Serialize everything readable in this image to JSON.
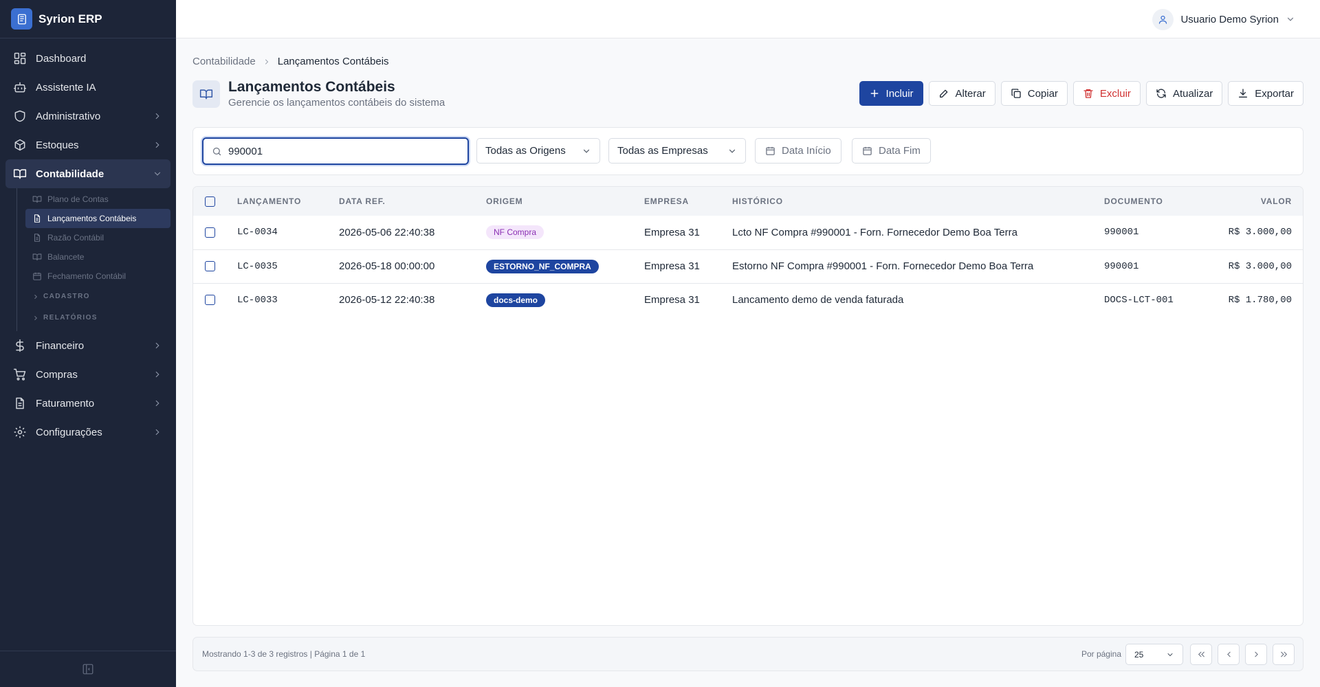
{
  "app": {
    "name": "Syrion ERP"
  },
  "sidebar": {
    "items": [
      {
        "label": "Dashboard",
        "icon": "dashboard-icon"
      },
      {
        "label": "Assistente IA",
        "icon": "bot-icon"
      },
      {
        "label": "Administrativo",
        "icon": "shield-icon"
      },
      {
        "label": "Estoques",
        "icon": "box-icon"
      },
      {
        "label": "Contabilidade",
        "icon": "book-icon"
      },
      {
        "label": "Financeiro",
        "icon": "dollar-icon"
      },
      {
        "label": "Compras",
        "icon": "cart-icon"
      },
      {
        "label": "Faturamento",
        "icon": "file-icon"
      },
      {
        "label": "Configurações",
        "icon": "gear-icon"
      }
    ],
    "sub_items": [
      {
        "label": "Plano de Contas"
      },
      {
        "label": "Lançamentos Contábeis"
      },
      {
        "label": "Razão Contábil"
      },
      {
        "label": "Balancete"
      },
      {
        "label": "Fechamento Contábil"
      }
    ],
    "groups": [
      {
        "label": "CADASTRO"
      },
      {
        "label": "RELATÓRIOS"
      }
    ]
  },
  "header": {
    "user_name": "Usuario Demo Syrion"
  },
  "breadcrumb": {
    "parent": "Contabilidade",
    "current": "Lançamentos Contábeis"
  },
  "page": {
    "title": "Lançamentos Contábeis",
    "subtitle": "Gerencie os lançamentos contábeis do sistema"
  },
  "actions": {
    "incluir": "Incluir",
    "alterar": "Alterar",
    "copiar": "Copiar",
    "excluir": "Excluir",
    "atualizar": "Atualizar",
    "exportar": "Exportar"
  },
  "filters": {
    "search_value": "990001",
    "origem": "Todas as Origens",
    "empresa": "Todas as Empresas",
    "data_inicio": "Data Início",
    "data_fim": "Data Fim"
  },
  "table": {
    "columns": {
      "lancamento": "LANÇAMENTO",
      "data_ref": "DATA REF.",
      "origem": "ORIGEM",
      "empresa": "EMPRESA",
      "historico": "HISTÓRICO",
      "documento": "DOCUMENTO",
      "valor": "VALOR"
    },
    "rows": [
      {
        "lancamento": "LC-0034",
        "data_ref": "2026-05-06 22:40:38",
        "origem": "NF Compra",
        "empresa": "Empresa 31",
        "historico": "Lcto NF Compra #990001 - Forn. Fornecedor Demo Boa Terra",
        "documento": "990001",
        "valor": "R$ 3.000,00"
      },
      {
        "lancamento": "LC-0035",
        "data_ref": "2026-05-18 00:00:00",
        "origem": "ESTORNO_NF_COMPRA",
        "empresa": "Empresa 31",
        "historico": "Estorno NF Compra #990001 - Forn. Fornecedor Demo Boa Terra",
        "documento": "990001",
        "valor": "R$ 3.000,00"
      },
      {
        "lancamento": "LC-0033",
        "data_ref": "2026-05-12 22:40:38",
        "origem": "docs-demo",
        "empresa": "Empresa 31",
        "historico": "Lancamento demo de venda faturada",
        "documento": "DOCS-LCT-001",
        "valor": "R$ 1.780,00"
      }
    ]
  },
  "pagination": {
    "info": "Mostrando 1-3 de 3 registros | Página 1 de 1",
    "per_page_label": "Por página",
    "per_page_value": "25"
  },
  "colors": {
    "sidebar_bg": "#1d2538",
    "primary": "#1e45a0",
    "danger": "#d03030",
    "badge_light_bg": "#f4e6fb",
    "badge_light_text": "#8a2fb3"
  }
}
